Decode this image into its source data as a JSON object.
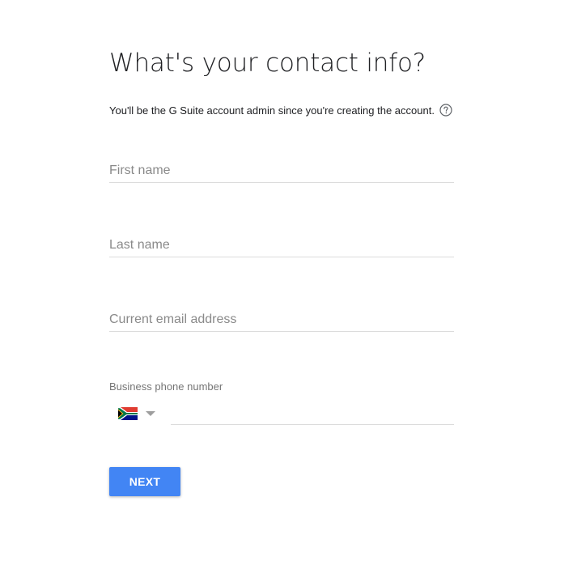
{
  "title": "What's your contact info?",
  "subtitle": "You'll be the G Suite account admin since you're creating the account.",
  "help_icon": "help-circle-icon",
  "fields": {
    "first_name": {
      "placeholder": "First name",
      "value": ""
    },
    "last_name": {
      "placeholder": "Last name",
      "value": ""
    },
    "email": {
      "placeholder": "Current email address",
      "value": ""
    }
  },
  "phone": {
    "label": "Business phone number",
    "country_flag_icon": "south-africa-flag-icon",
    "dropdown_icon": "dropdown-arrow-icon",
    "value": ""
  },
  "next_button": {
    "label": "NEXT",
    "color": "#4285f4"
  },
  "colors": {
    "accent": "#4285f4",
    "divider": "#dcdcdc",
    "placeholder": "#8a8a8a"
  }
}
